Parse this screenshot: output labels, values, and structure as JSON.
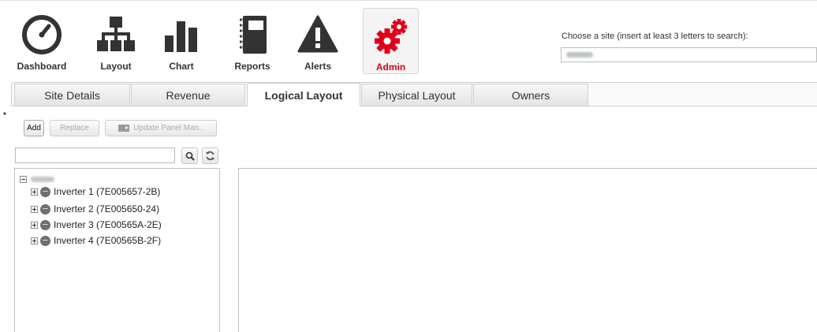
{
  "nav": {
    "items": [
      {
        "label": "Dashboard",
        "icon": "dashboard-gauge-icon"
      },
      {
        "label": "Layout",
        "icon": "layout-hierarchy-icon"
      },
      {
        "label": "Chart",
        "icon": "bar-chart-icon"
      },
      {
        "label": "Reports",
        "icon": "reports-notebook-icon"
      },
      {
        "label": "Alerts",
        "icon": "alert-triangle-icon"
      },
      {
        "label": "Admin",
        "icon": "admin-gears-icon",
        "active": true
      }
    ]
  },
  "site_chooser": {
    "label": "Choose a site (insert at least 3 letters to search):"
  },
  "tabs": [
    {
      "label": "Site Details"
    },
    {
      "label": "Revenue"
    },
    {
      "label": "Logical Layout",
      "active": true
    },
    {
      "label": "Physical Layout"
    },
    {
      "label": "Owners"
    }
  ],
  "toolbar": {
    "add_label": "Add",
    "replace_label": "Replace",
    "update_label": "Update Panel Man.."
  },
  "tree": {
    "inverters": [
      {
        "label": "Inverter 1 (7E005657-2B)"
      },
      {
        "label": "Inverter 2 (7E005650-24)"
      },
      {
        "label": "Inverter 3 (7E00565A-2E)"
      },
      {
        "label": "Inverter 4 (7E00565B-2F)"
      }
    ]
  },
  "colors": {
    "active_accent": "#e0001b",
    "icon_dark": "#333333"
  }
}
